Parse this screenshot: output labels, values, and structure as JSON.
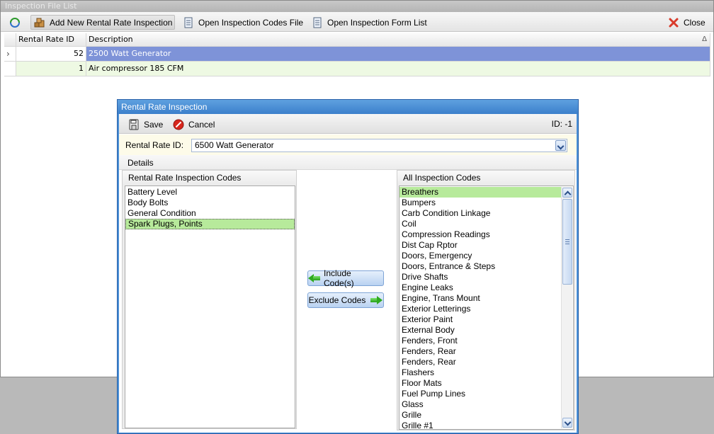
{
  "main": {
    "title": "Inspection File List",
    "toolbar": {
      "add_label": "Add New Rental Rate Inspection",
      "open_codes_label": "Open Inspection Codes File",
      "open_forms_label": "Open Inspection Form List",
      "close_label": "Close"
    },
    "grid": {
      "columns": [
        "Rental Rate ID",
        "Description"
      ],
      "sort_indicator": "Δ",
      "row_indicator": "›",
      "rows": [
        {
          "id": "52",
          "description": "2500 Watt Generator",
          "selected": true
        },
        {
          "id": "1",
          "description": "Air compressor 185 CFM",
          "selected": false
        }
      ]
    }
  },
  "dialog": {
    "title": "Rental Rate Inspection",
    "save_label": "Save",
    "cancel_label": "Cancel",
    "id_text": "ID: -1",
    "rate_label": "Rental Rate ID:",
    "rate_value": "6500 Watt Generator",
    "details_tab": "Details",
    "left_header": "Rental Rate Inspection Codes",
    "left_items": [
      "Battery Level",
      "Body Bolts",
      "General Condition",
      "Spark Plugs, Points"
    ],
    "left_selected_index": 3,
    "include_label": "Include Code(s)",
    "exclude_label": "Exclude Codes",
    "right_header": "All Inspection Codes",
    "right_items": [
      "Breathers",
      "Bumpers",
      "Carb Condition Linkage",
      "Coil",
      "Compression Readings",
      "Dist Cap Rptor",
      "Doors, Emergency",
      "Doors, Entrance & Steps",
      "Drive Shafts",
      "Engine Leaks",
      "Engine, Trans Mount",
      "Exterior Letterings",
      "Exterior Paint",
      "External Body",
      "Fenders, Front",
      "Fenders, Rear",
      "Fenders, Rear",
      "Flashers",
      "Floor Mats",
      "Fuel Pump Lines",
      "Glass",
      "Grille",
      "Grille #1"
    ],
    "right_selected_index": 0
  },
  "colors": {
    "selected_row": "#7e93d8",
    "alt_row": "#eef9e3",
    "list_selection": "#b7ea9b",
    "dialog_frame": "#4a8fd6"
  }
}
